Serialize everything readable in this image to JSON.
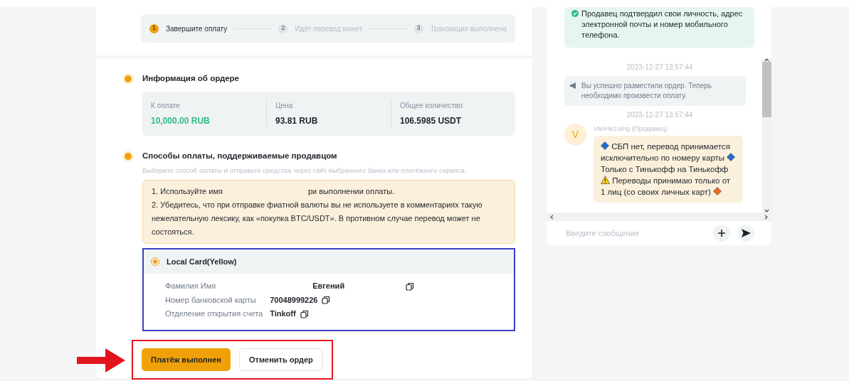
{
  "stepper": [
    {
      "number": "1",
      "label": "Завершите оплату",
      "selected": true
    },
    {
      "number": "2",
      "label": "Идёт перевод монет",
      "selected": false
    },
    {
      "number": "3",
      "label": "Транзакция выполнена",
      "selected": false
    }
  ],
  "order_info": {
    "title": "Информация об ордере",
    "fields": [
      {
        "label": "К оплате",
        "value": "10,000.00 RUB",
        "kind": "amount"
      },
      {
        "label": "Цена",
        "value": "93.81 RUB",
        "kind": "plain"
      },
      {
        "label": "Общее количество",
        "value": "106.5985 USDT",
        "kind": "plain"
      }
    ]
  },
  "payment": {
    "title": "Способы оплаты, поддерживаемые продавцом",
    "hint": "Выберите способ оплаты и отправьте средства через сайт выбранного банка или платёжного сервиса.",
    "notices": [
      {
        "parts": [
          "1. Используйте имя",
          "ри выполнении оплаты."
        ]
      },
      {
        "parts": [
          "2. Убедитесь, что при отправке фиатной валюты вы не используете в комментариях такую нежелательную лексику, как «покупка BTC/USDT». В противном случае перевод может не состояться."
        ]
      }
    ],
    "method": {
      "name": "Local Card(Yellow)",
      "selected": true,
      "highlighted": true,
      "details": [
        {
          "label": "Фамилия Имя",
          "value": "Евгений"
        },
        {
          "label": "Номер банковской карты",
          "value": "70048999226"
        },
        {
          "label": "Отделение открытия счета",
          "value": "Tinkoff"
        }
      ]
    }
  },
  "actions": {
    "highlighted": true,
    "pointer_arrow": true,
    "buttons": [
      {
        "label": "Платёж выполнен",
        "kind": "primary"
      },
      {
        "label": "Отменить ордер",
        "kind": "secondary"
      }
    ]
  },
  "chat": {
    "verified_notice": "Продавец подтвердил свои личность, адрес электронной почты и номер мобильного телефона.",
    "messages": [
      {
        "kind": "timestamp",
        "text": "2023-12-27 13:57:44"
      },
      {
        "kind": "system",
        "text": "Вы успешно разместили ордер. Теперь необходимо произвести оплату."
      },
      {
        "kind": "timestamp",
        "text": "2023-12-27 13:57:44"
      },
      {
        "kind": "user",
        "avatar": "V",
        "sender": "VanHe1sing (Продавец)",
        "segments": [
          {
            "kind": "diamond",
            "color": "#1f6fd1"
          },
          {
            "kind": "text",
            "text": "СБП нет, перевод принимается исключительно по номеру карты"
          },
          {
            "kind": "diamond",
            "color": "#1f6fd1"
          },
          {
            "kind": "text",
            "text": "Только с Тинькофф на Тинькофф"
          },
          {
            "kind": "warning"
          },
          {
            "kind": "text",
            "text": "Переводы принимаю только от 1 лиц (со своих личных карт)"
          },
          {
            "kind": "diamond",
            "color": "#f26b1d"
          }
        ]
      }
    ],
    "input": {
      "placeholder": "Введите сообщение"
    }
  }
}
